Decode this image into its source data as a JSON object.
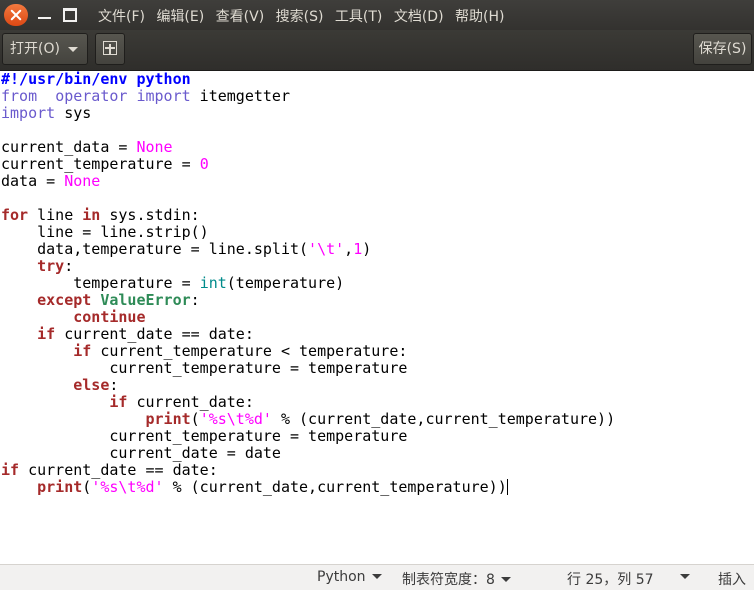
{
  "menubar": {
    "items": [
      "文件(F)",
      "编辑(E)",
      "查看(V)",
      "搜索(S)",
      "工具(T)",
      "文档(D)",
      "帮助(H)"
    ]
  },
  "toolbar": {
    "open_label": "打开(O)",
    "new_icon": "new-document-icon",
    "save_label": "保存(S)"
  },
  "editor": {
    "language": "python",
    "lines": [
      [
        [
          "sheb",
          "#!/usr/bin/env python"
        ]
      ],
      [
        [
          "kw2",
          "from"
        ],
        [
          "",
          "  "
        ],
        [
          "kw2",
          "operator"
        ],
        [
          "",
          ""
        ],
        [
          "kw2",
          " import"
        ],
        [
          "",
          " itemgetter"
        ]
      ],
      [
        [
          "kw2",
          "import"
        ],
        [
          "",
          " sys"
        ]
      ],
      [],
      [
        [
          "",
          "current_data = "
        ],
        [
          "const",
          "None"
        ]
      ],
      [
        [
          "",
          "current_temperature = "
        ],
        [
          "num",
          "0"
        ]
      ],
      [
        [
          "",
          "data = "
        ],
        [
          "const",
          "None"
        ]
      ],
      [],
      [
        [
          "kw",
          "for"
        ],
        [
          "",
          " line "
        ],
        [
          "kw",
          "in"
        ],
        [
          "",
          " sys.stdin:"
        ]
      ],
      [
        [
          "",
          "    line = line.strip()"
        ]
      ],
      [
        [
          "",
          "    data,temperature = line.split("
        ],
        [
          "str",
          "'\\t'"
        ],
        [
          "",
          ","
        ],
        [
          "num",
          "1"
        ],
        [
          "",
          ")"
        ]
      ],
      [
        [
          "",
          "    "
        ],
        [
          "kw",
          "try"
        ],
        [
          "",
          ":"
        ]
      ],
      [
        [
          "",
          "        temperature = "
        ],
        [
          "builtin",
          "int"
        ],
        [
          "",
          "(temperature)"
        ]
      ],
      [
        [
          "",
          "    "
        ],
        [
          "kw",
          "except"
        ],
        [
          "",
          ""
        ],
        [
          "exc",
          " ValueError"
        ],
        [
          "",
          ":"
        ]
      ],
      [
        [
          "",
          "        "
        ],
        [
          "kw",
          "continue"
        ]
      ],
      [
        [
          "",
          "    "
        ],
        [
          "kw",
          "if"
        ],
        [
          "",
          " current_date == date:"
        ]
      ],
      [
        [
          "",
          "        "
        ],
        [
          "kw",
          "if"
        ],
        [
          "",
          " current_temperature < temperature:"
        ]
      ],
      [
        [
          "",
          "            current_temperature = temperature"
        ]
      ],
      [
        [
          "",
          "        "
        ],
        [
          "kw",
          "else"
        ],
        [
          "",
          ":"
        ]
      ],
      [
        [
          "",
          "            "
        ],
        [
          "kw",
          "if"
        ],
        [
          "",
          " current_date:"
        ]
      ],
      [
        [
          "",
          "                "
        ],
        [
          "kw",
          "print"
        ],
        [
          "",
          "("
        ],
        [
          "str",
          "'%s\\t%d'"
        ],
        [
          "",
          " % (current_date,current_temperature))"
        ]
      ],
      [
        [
          "",
          "            current_temperature = temperature"
        ]
      ],
      [
        [
          "",
          "            current_date = date"
        ]
      ],
      [
        [
          "kw",
          "if"
        ],
        [
          "",
          " current_date == date:"
        ]
      ],
      [
        [
          "",
          "    "
        ],
        [
          "kw",
          "print"
        ],
        [
          "",
          "("
        ],
        [
          "str",
          "'%s\\t%d'"
        ],
        [
          "",
          " % (current_date,current_temperature))"
        ]
      ]
    ],
    "caret_line": 24
  },
  "statusbar": {
    "language": "Python",
    "tab_width": "制表符宽度：8",
    "position": "行 25，列 57",
    "mode": "插入"
  },
  "colors": {
    "menubar_bg": "#3c3b37",
    "close_button": "#e95420",
    "keyword": "#a52a2a",
    "constant": "#ff00ff",
    "builtin": "#008b8b",
    "exception": "#2e8b57",
    "shebang": "#0000ff",
    "import_keyword": "#6a5acd"
  }
}
